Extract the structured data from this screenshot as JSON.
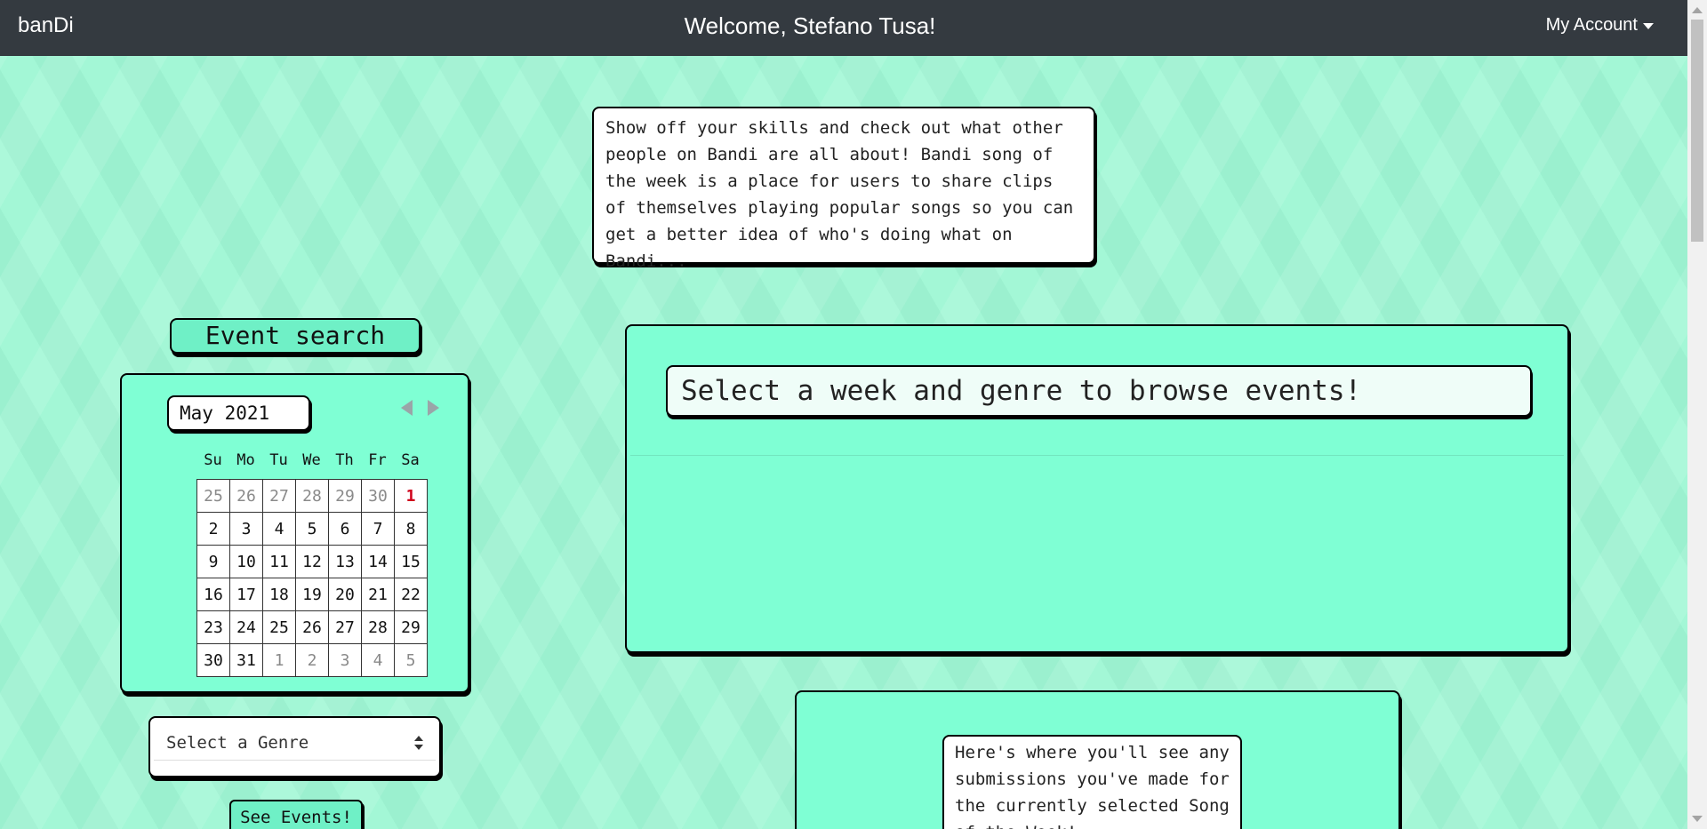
{
  "navbar": {
    "brand": "banDi",
    "welcome": "Welcome, Stefano Tusa!",
    "account_label": "My Account"
  },
  "intro": {
    "text": "Show off your skills and check out what other people on Bandi are all about! Bandi song of the week is a place for users to share clips of themselves playing popular songs so you can get a better idea of who's doing what on Bandi..."
  },
  "event_search": {
    "title": "Event search",
    "calendar": {
      "month_label": "May 2021",
      "weekdays": [
        "Su",
        "Mo",
        "Tu",
        "We",
        "Th",
        "Fr",
        "Sa"
      ],
      "weeks": [
        [
          "25",
          "26",
          "27",
          "28",
          "29",
          "30",
          "1"
        ],
        [
          "2",
          "3",
          "4",
          "5",
          "6",
          "7",
          "8"
        ],
        [
          "9",
          "10",
          "11",
          "12",
          "13",
          "14",
          "15"
        ],
        [
          "16",
          "17",
          "18",
          "19",
          "20",
          "21",
          "22"
        ],
        [
          "23",
          "24",
          "25",
          "26",
          "27",
          "28",
          "29"
        ],
        [
          "30",
          "31",
          "1",
          "2",
          "3",
          "4",
          "5"
        ]
      ],
      "today": "1"
    },
    "genre_select": {
      "selected": "Select a Genre"
    },
    "see_events_label": "See Events!"
  },
  "events_panel": {
    "header": "Select a week and genre to browse events!"
  },
  "submissions_panel": {
    "note": "Here's where you'll see any submissions you've made for the currently selected Song of the Week!"
  },
  "colors": {
    "navbar_bg": "#343a40",
    "card_bg": "#7fffd4",
    "accent": "#6ff0c6",
    "page_bg": "#a3f7d6",
    "today": "#d0021b"
  }
}
